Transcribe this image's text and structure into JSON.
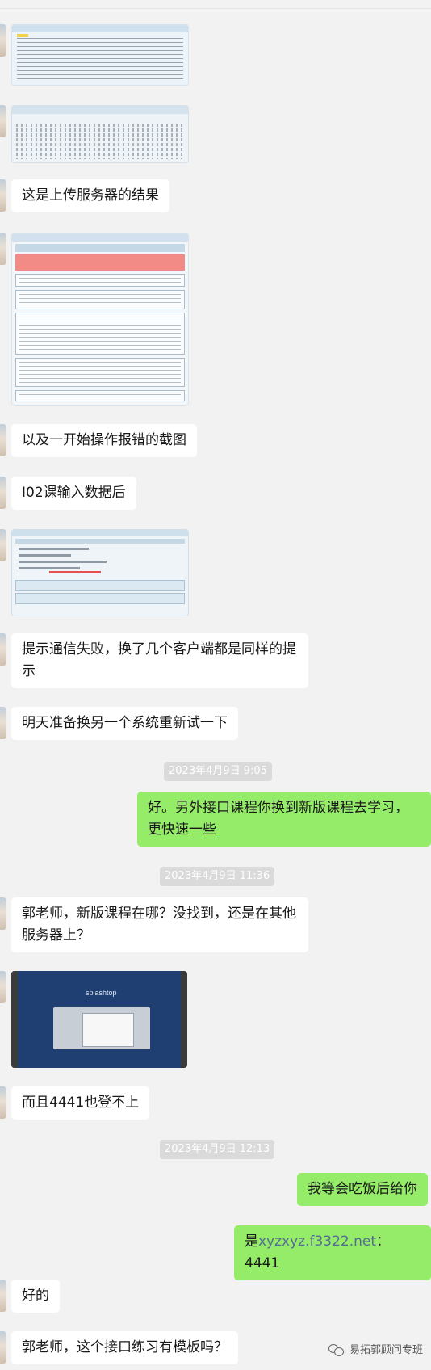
{
  "messages": [
    {
      "id": "m1",
      "text": "这是上传服务器的结果"
    },
    {
      "id": "m2",
      "text": "以及一开始操作报错的截图"
    },
    {
      "id": "m3",
      "text": "I02课输入数据后"
    },
    {
      "id": "m4",
      "text": "提示通信失败，换了几个客户端都是同样的提示"
    },
    {
      "id": "m5",
      "text": "明天准备换另一个系统重新试一下"
    },
    {
      "id": "m6",
      "text": "好。另外接口课程你换到新版课程去学习，更快速一些"
    },
    {
      "id": "m7",
      "text": "郭老师，新版课程在哪？没找到，还是在其他服务器上？"
    },
    {
      "id": "m8",
      "text": "而且4441也登不上"
    },
    {
      "id": "m9",
      "text": "我等会吃饭后给你"
    },
    {
      "id": "m10",
      "prefix": "是",
      "link": "xyzxyz.f3322.net",
      "suffix": "：4441"
    },
    {
      "id": "m11",
      "text": "好的"
    },
    {
      "id": "m12",
      "text": "郭老师，这个接口练习有模板吗？"
    }
  ],
  "timestamps": {
    "t1": "2023年4月9日 9:05",
    "t2": "2023年4月9日 11:36",
    "t3": "2023年4月9日 12:13"
  },
  "images": {
    "login_brand": "splashtop"
  },
  "footer": {
    "text": "易拓郭顾问专班",
    "icon": "wechat-official-icon"
  }
}
